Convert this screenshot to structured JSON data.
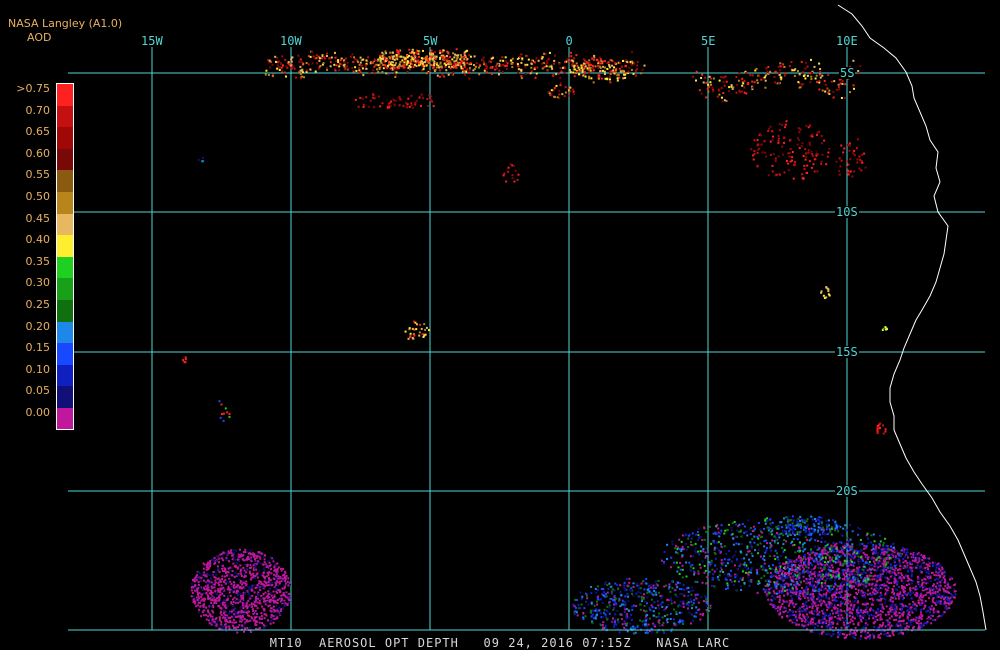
{
  "header": {
    "title": "NASA Langley (A1.0)",
    "subtitle": "AOD"
  },
  "color_scale": {
    "labels": [
      ">0.75",
      "0.70",
      "0.65",
      "0.60",
      "0.55",
      "0.50",
      "0.45",
      "0.40",
      "0.35",
      "0.30",
      "0.25",
      "0.20",
      "0.15",
      "0.10",
      "0.05",
      "0.00"
    ],
    "colors": [
      "#ff2020",
      "#c41010",
      "#a00808",
      "#7a0808",
      "#8a5a10",
      "#b8841c",
      "#e8b860",
      "#ffee30",
      "#20d020",
      "#18a018",
      "#107010",
      "#1e88e8",
      "#1848ff",
      "#1020c0",
      "#101078",
      "#c0189c"
    ]
  },
  "axes": {
    "longitude_labels": [
      "15W",
      "10W",
      "5W",
      "0",
      "5E",
      "10E"
    ],
    "latitude_labels": [
      "5S",
      "10S",
      "15S",
      "20S"
    ]
  },
  "footer": {
    "text": "MT10  AEROSOL OPT DEPTH   09 24, 2016 07:15Z   NASA LARC"
  },
  "colors": {
    "grid": "#4fd6d6",
    "coast": "#ffffff",
    "clean_air": "#c0189c"
  }
}
